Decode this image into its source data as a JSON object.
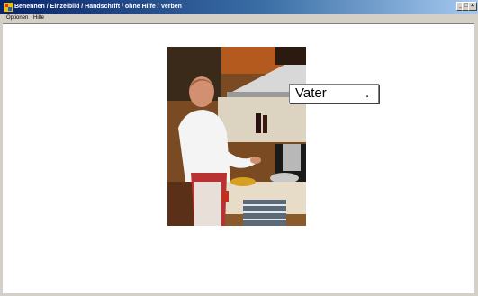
{
  "window": {
    "title": "Benennen / Einzelbild / Handschrift / ohne Hilfe / Verben",
    "controls": {
      "minimize": "_",
      "maximize": "□",
      "close": "×"
    }
  },
  "menu": {
    "items": [
      {
        "label": "Optionen"
      },
      {
        "label": "Hilfe"
      }
    ]
  },
  "picture": {
    "icon": "photo-cook-in-kitchen"
  },
  "answer": {
    "text": "Vater",
    "cursor": "."
  }
}
